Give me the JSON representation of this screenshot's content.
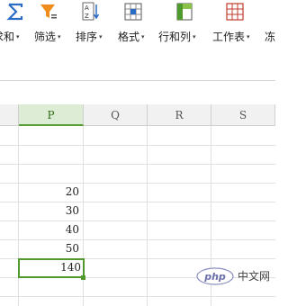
{
  "toolbar": {
    "items": [
      {
        "label": "求和",
        "icon": "sum-icon"
      },
      {
        "label": "筛选",
        "icon": "filter-icon"
      },
      {
        "label": "排序",
        "icon": "sort-icon"
      },
      {
        "label": "格式",
        "icon": "format-icon"
      },
      {
        "label": "行和列",
        "icon": "rows-columns-icon"
      },
      {
        "label": "工作表",
        "icon": "worksheet-icon"
      },
      {
        "label": "冻",
        "icon": "freeze-icon"
      }
    ],
    "caret": "▾"
  },
  "grid": {
    "columns": [
      "P",
      "Q",
      "R",
      "S"
    ],
    "active_column": "P",
    "values": [
      "20",
      "30",
      "40",
      "50",
      "140"
    ],
    "selected_value": "140"
  },
  "watermark": {
    "logo_text": "php",
    "text": "中文网"
  },
  "colors": {
    "accent_green": "#4f9a2c",
    "sum_icon_blue": "#2b6cc4",
    "filter_icon_orange": "#f08c1c"
  }
}
